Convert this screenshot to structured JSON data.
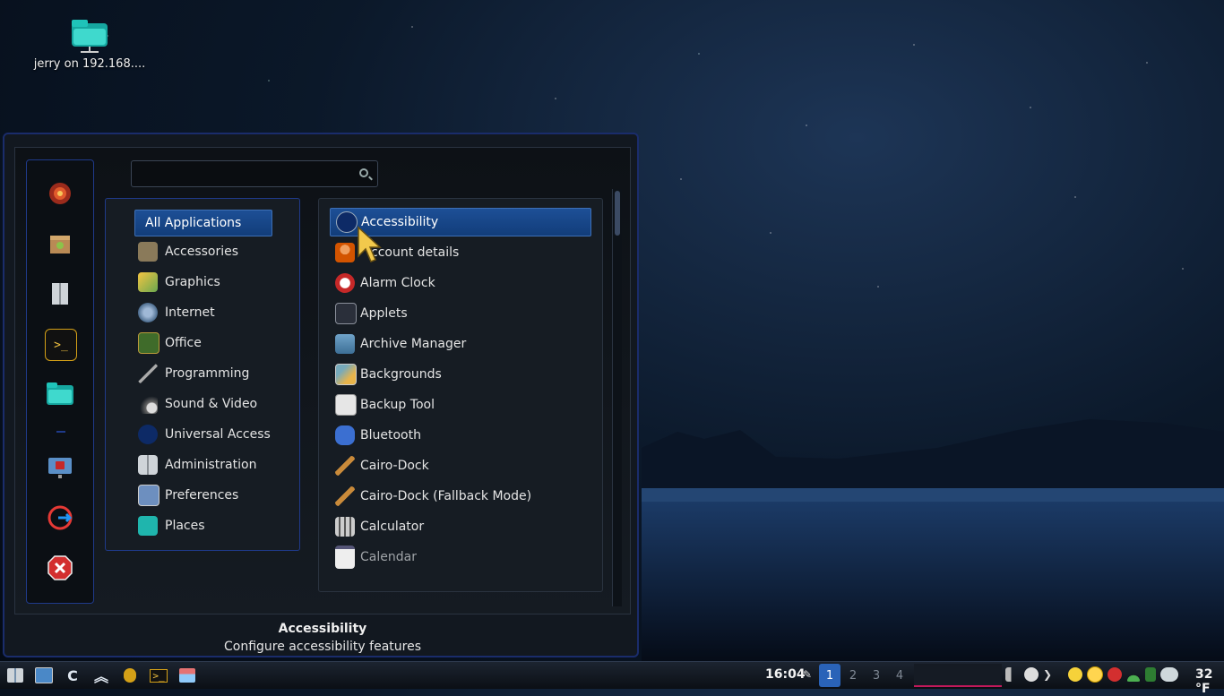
{
  "desktop": {
    "icon_label": "jerry on 192.168...."
  },
  "menu": {
    "search_placeholder": "",
    "categories": [
      {
        "label": "All Applications",
        "icon": "all-apps-icon"
      },
      {
        "label": "Accessories",
        "icon": "accessories-icon"
      },
      {
        "label": "Graphics",
        "icon": "graphics-icon"
      },
      {
        "label": "Internet",
        "icon": "internet-icon"
      },
      {
        "label": "Office",
        "icon": "office-icon"
      },
      {
        "label": "Programming",
        "icon": "programming-icon"
      },
      {
        "label": "Sound & Video",
        "icon": "sound-video-icon"
      },
      {
        "label": "Universal Access",
        "icon": "universal-access-icon"
      },
      {
        "label": "Administration",
        "icon": "administration-icon"
      },
      {
        "label": "Preferences",
        "icon": "preferences-icon"
      },
      {
        "label": "Places",
        "icon": "places-icon"
      }
    ],
    "apps": [
      {
        "label": "Accessibility",
        "icon": "accessibility-icon"
      },
      {
        "label": "ccount details",
        "icon": "account-details-icon"
      },
      {
        "label": "Alarm Clock",
        "icon": "alarm-clock-icon"
      },
      {
        "label": "Applets",
        "icon": "applets-icon"
      },
      {
        "label": "Archive Manager",
        "icon": "archive-manager-icon"
      },
      {
        "label": "Backgrounds",
        "icon": "backgrounds-icon"
      },
      {
        "label": "Backup Tool",
        "icon": "backup-tool-icon"
      },
      {
        "label": "Bluetooth",
        "icon": "bluetooth-icon"
      },
      {
        "label": "Cairo-Dock",
        "icon": "cairo-dock-icon"
      },
      {
        "label": "Cairo-Dock (Fallback Mode)",
        "icon": "cairo-dock-fallback-icon"
      },
      {
        "label": "Calculator",
        "icon": "calculator-icon"
      },
      {
        "label": "Calendar",
        "icon": "calendar-icon"
      }
    ],
    "description_title": "Accessibility",
    "description_text": "Configure accessibility features"
  },
  "taskbar": {
    "clock": "16:04",
    "workspaces": [
      "1",
      "2",
      "3",
      "4"
    ],
    "temperature": "32 °F"
  },
  "colors": {
    "accent": "#1d4f96",
    "border": "#1f3a8a",
    "task_indicator": "#c2185b"
  }
}
